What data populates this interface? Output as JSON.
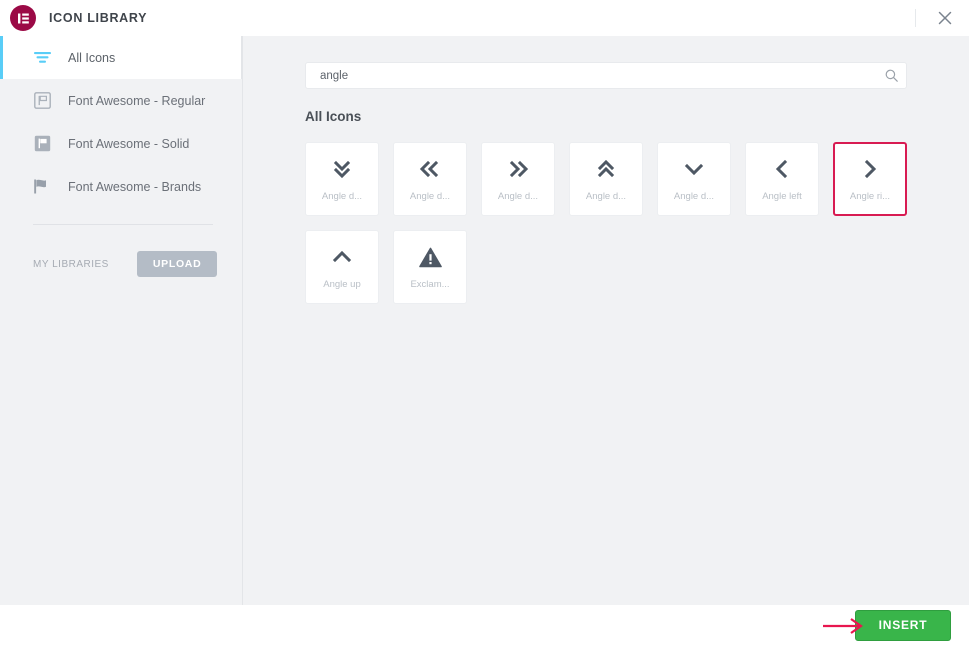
{
  "header": {
    "title": "ICON LIBRARY",
    "logo_icon": "elementor-logo-icon",
    "close_icon": "close-icon",
    "brand_color": "#9b0a46"
  },
  "sidebar": {
    "items": [
      {
        "label": "All Icons",
        "icon": "filter-lines-icon",
        "active": true
      },
      {
        "label": "Font Awesome - Regular",
        "icon": "flag-regular-icon",
        "active": false
      },
      {
        "label": "Font Awesome - Solid",
        "icon": "flag-solid-icon",
        "active": false
      },
      {
        "label": "Font Awesome - Brands",
        "icon": "flag-brands-icon",
        "active": false
      }
    ],
    "my_libraries_label": "MY LIBRARIES",
    "upload_label": "UPLOAD",
    "active_accent_color": "#59cdf7"
  },
  "search": {
    "value": "angle",
    "placeholder": "Search icons",
    "icon": "search-icon"
  },
  "main": {
    "section_title": "All Icons",
    "selected_index": 6,
    "selection_color": "#d81b52",
    "icons": [
      {
        "label": "Angle d...",
        "glyph": "angle-double-down-icon"
      },
      {
        "label": "Angle d...",
        "glyph": "angle-double-left-icon"
      },
      {
        "label": "Angle d...",
        "glyph": "angle-double-right-icon"
      },
      {
        "label": "Angle d...",
        "glyph": "angle-double-up-icon"
      },
      {
        "label": "Angle d...",
        "glyph": "angle-down-icon"
      },
      {
        "label": "Angle left",
        "glyph": "angle-left-icon"
      },
      {
        "label": "Angle ri...",
        "glyph": "angle-right-icon"
      },
      {
        "label": "Angle up",
        "glyph": "angle-up-icon"
      },
      {
        "label": "Exclam...",
        "glyph": "exclamation-triangle-icon"
      }
    ]
  },
  "footer": {
    "insert_label": "INSERT",
    "insert_color": "#39b54a",
    "annotation_arrow_color": "#e8164f"
  }
}
